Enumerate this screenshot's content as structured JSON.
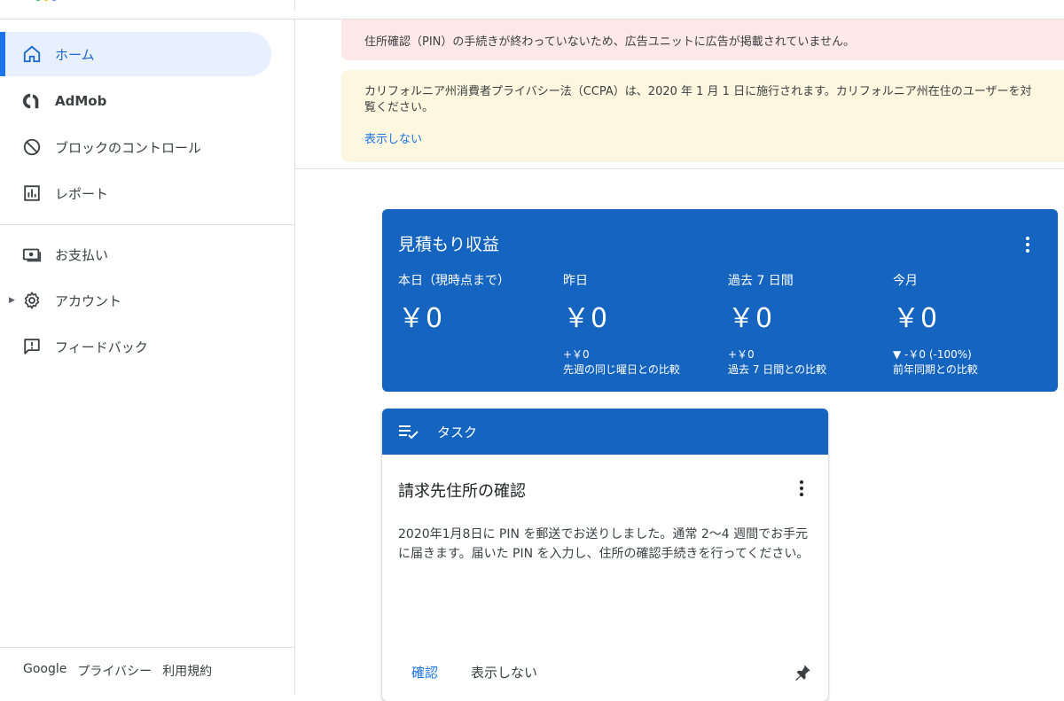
{
  "sidebar": {
    "items": [
      {
        "label": "ホーム",
        "icon": "home-icon"
      },
      {
        "label": "AdMob",
        "icon": "admob-icon"
      },
      {
        "label": "ブロックのコントロール",
        "icon": "block-icon"
      },
      {
        "label": "レポート",
        "icon": "report-icon"
      },
      {
        "label": "お支払い",
        "icon": "payments-icon"
      },
      {
        "label": "アカウント",
        "icon": "gear-icon"
      },
      {
        "label": "フィードバック",
        "icon": "feedback-icon"
      }
    ],
    "footer": {
      "google": "Google",
      "privacy": "プライバシー",
      "terms": "利用規約"
    }
  },
  "banners": {
    "pin_warning": "住所確認（PIN）の手続きが終わっていないため、広告ユニットに広告が掲載されていません。",
    "ccpa_line1": "カリフォルニア州消費者プライバシー法（CCPA）は、2020 年 1 月 1 日に施行されます。カリフォルニア州在住のユーザーを対",
    "ccpa_line2": "覧ください。",
    "ccpa_dismiss": "表示しない"
  },
  "earnings": {
    "title": "見積もり収益",
    "columns": [
      {
        "heading": "本日（現時点まで）",
        "value": "￥0",
        "delta": "",
        "compare": ""
      },
      {
        "heading": "昨日",
        "value": "￥0",
        "delta": "+￥0",
        "compare": "先週の同じ曜日との比較"
      },
      {
        "heading": "過去 7 日間",
        "value": "￥0",
        "delta": "+￥0",
        "compare": "過去 7 日間との比較"
      },
      {
        "heading": "今月",
        "value": "￥0",
        "delta": "▼ -￥0 (-100%)",
        "compare": "前年同期との比較"
      }
    ]
  },
  "task": {
    "header": "タスク",
    "title": "請求先住所の確認",
    "body": "2020年1月8日に PIN を郵送でお送りしました。通常 2〜4 週間でお手元に届きます。届いた PIN を入力し、住所の確認手続きを行ってください。",
    "confirm": "確認",
    "dismiss": "表示しない"
  },
  "colors": {
    "accent": "#1a73e8",
    "card_blue": "#1565c0",
    "active_bg": "#e8f0fe",
    "error_bg": "#fce8e6",
    "warn_bg": "#fef7e0"
  }
}
